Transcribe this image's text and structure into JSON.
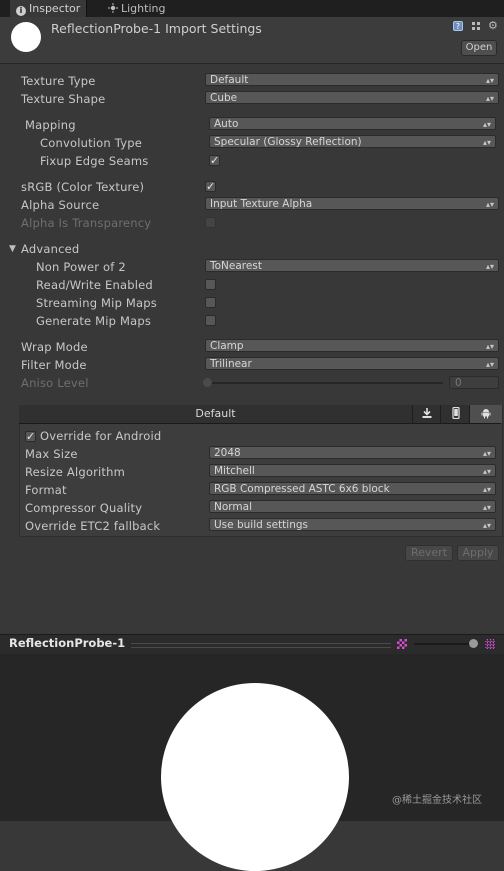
{
  "tabs": [
    {
      "label": "Inspector",
      "icon": "info-icon",
      "active": true
    },
    {
      "label": "Lighting",
      "icon": "lighting-icon",
      "active": false
    }
  ],
  "header": {
    "title": "ReflectionProbe-1 Import Settings",
    "open_label": "Open"
  },
  "settings": {
    "texture_type": {
      "label": "Texture Type",
      "value": "Default"
    },
    "texture_shape": {
      "label": "Texture Shape",
      "value": "Cube"
    },
    "mapping": {
      "label": "Mapping",
      "value": "Auto"
    },
    "convolution_type": {
      "label": "Convolution Type",
      "value": "Specular (Glossy Reflection)"
    },
    "fixup_edge_seams": {
      "label": "Fixup Edge Seams",
      "checked": true
    },
    "srgb": {
      "label": "sRGB (Color Texture)",
      "checked": true
    },
    "alpha_source": {
      "label": "Alpha Source",
      "value": "Input Texture Alpha"
    },
    "alpha_is_transparency": {
      "label": "Alpha Is Transparency",
      "checked": false,
      "disabled": true
    },
    "advanced": {
      "label": "Advanced",
      "expanded": true
    },
    "non_power_of_2": {
      "label": "Non Power of 2",
      "value": "ToNearest"
    },
    "read_write": {
      "label": "Read/Write Enabled",
      "checked": false
    },
    "streaming_mip_maps": {
      "label": "Streaming Mip Maps",
      "checked": false
    },
    "generate_mip_maps": {
      "label": "Generate Mip Maps",
      "checked": false
    },
    "wrap_mode": {
      "label": "Wrap Mode",
      "value": "Clamp"
    },
    "filter_mode": {
      "label": "Filter Mode",
      "value": "Trilinear"
    },
    "aniso_level": {
      "label": "Aniso Level",
      "value": "0",
      "slider_fraction": 0
    }
  },
  "platform": {
    "tabs": [
      {
        "label": "Default",
        "selected": false
      },
      {
        "icon": "download-icon",
        "selected": false
      },
      {
        "icon": "phone-icon",
        "selected": false
      },
      {
        "icon": "android-icon",
        "selected": true
      }
    ],
    "override": {
      "label": "Override for Android",
      "checked": true
    },
    "max_size": {
      "label": "Max Size",
      "value": "2048"
    },
    "resize_algorithm": {
      "label": "Resize Algorithm",
      "value": "Mitchell"
    },
    "format": {
      "label": "Format",
      "value": "RGB Compressed ASTC 6x6 block"
    },
    "compressor_quality": {
      "label": "Compressor Quality",
      "value": "Normal"
    },
    "etc2_fallback": {
      "label": "Override ETC2 fallback",
      "value": "Use build settings"
    }
  },
  "actions": {
    "revert_label": "Revert",
    "apply_label": "Apply"
  },
  "preview": {
    "title": "ReflectionProbe-1"
  },
  "watermark": "@稀土掘金技术社区",
  "colors": {
    "background": "#383838",
    "header": "#3c3c3c",
    "dropdown": "#575757",
    "preview_bg": "#262626",
    "mip_checker": "#d34cd3"
  }
}
